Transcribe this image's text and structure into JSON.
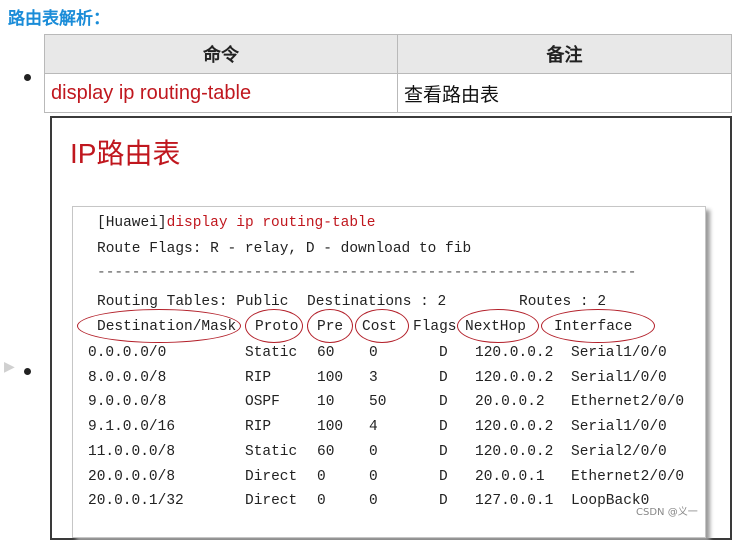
{
  "heading": "路由表解析：",
  "command_table": {
    "headers": [
      "命令",
      "备注"
    ],
    "rows": [
      [
        "display ip routing-table",
        "查看路由表"
      ]
    ]
  },
  "slide": {
    "title": "IP路由表",
    "prompt": "[Huawei]",
    "command": "display ip routing-table",
    "flags_line": "Route Flags: R - relay, D - download to fib",
    "separator": "--------------------------------------------------------------",
    "summary": {
      "label": "Routing Tables: Public",
      "destinations": "Destinations : 2",
      "routes": "Routes : 2"
    },
    "columns": [
      "Destination/Mask",
      "Proto",
      "Pre",
      "Cost",
      "Flags",
      "NextHop",
      "Interface"
    ],
    "rows": [
      [
        "0.0.0.0/0",
        "Static",
        "60",
        "0",
        "D",
        "120.0.0.2",
        "Serial1/0/0"
      ],
      [
        "8.0.0.0/8",
        "RIP",
        "100",
        "3",
        "D",
        "120.0.0.2",
        "Serial1/0/0"
      ],
      [
        "9.0.0.0/8",
        "OSPF",
        "10",
        "50",
        "D",
        "20.0.0.2",
        "Ethernet2/0/0"
      ],
      [
        "9.1.0.0/16",
        "RIP",
        "100",
        "4",
        "D",
        "120.0.0.2",
        "Serial1/0/0"
      ],
      [
        "11.0.0.0/8",
        "Static",
        "60",
        "0",
        "D",
        "120.0.0.2",
        "Serial2/0/0"
      ],
      [
        "20.0.0.0/8",
        "Direct",
        "0",
        "0",
        "D",
        "20.0.0.1",
        "Ethernet2/0/0"
      ],
      [
        "20.0.0.1/32",
        "Direct",
        "0",
        "0",
        "D",
        "127.0.0.1",
        "LoopBack0"
      ]
    ]
  },
  "watermark": "CSDN @义一",
  "colors": {
    "accent_blue": "#1a8cd8",
    "command_red": "#c0171e",
    "oval_red": "#b3202a"
  }
}
